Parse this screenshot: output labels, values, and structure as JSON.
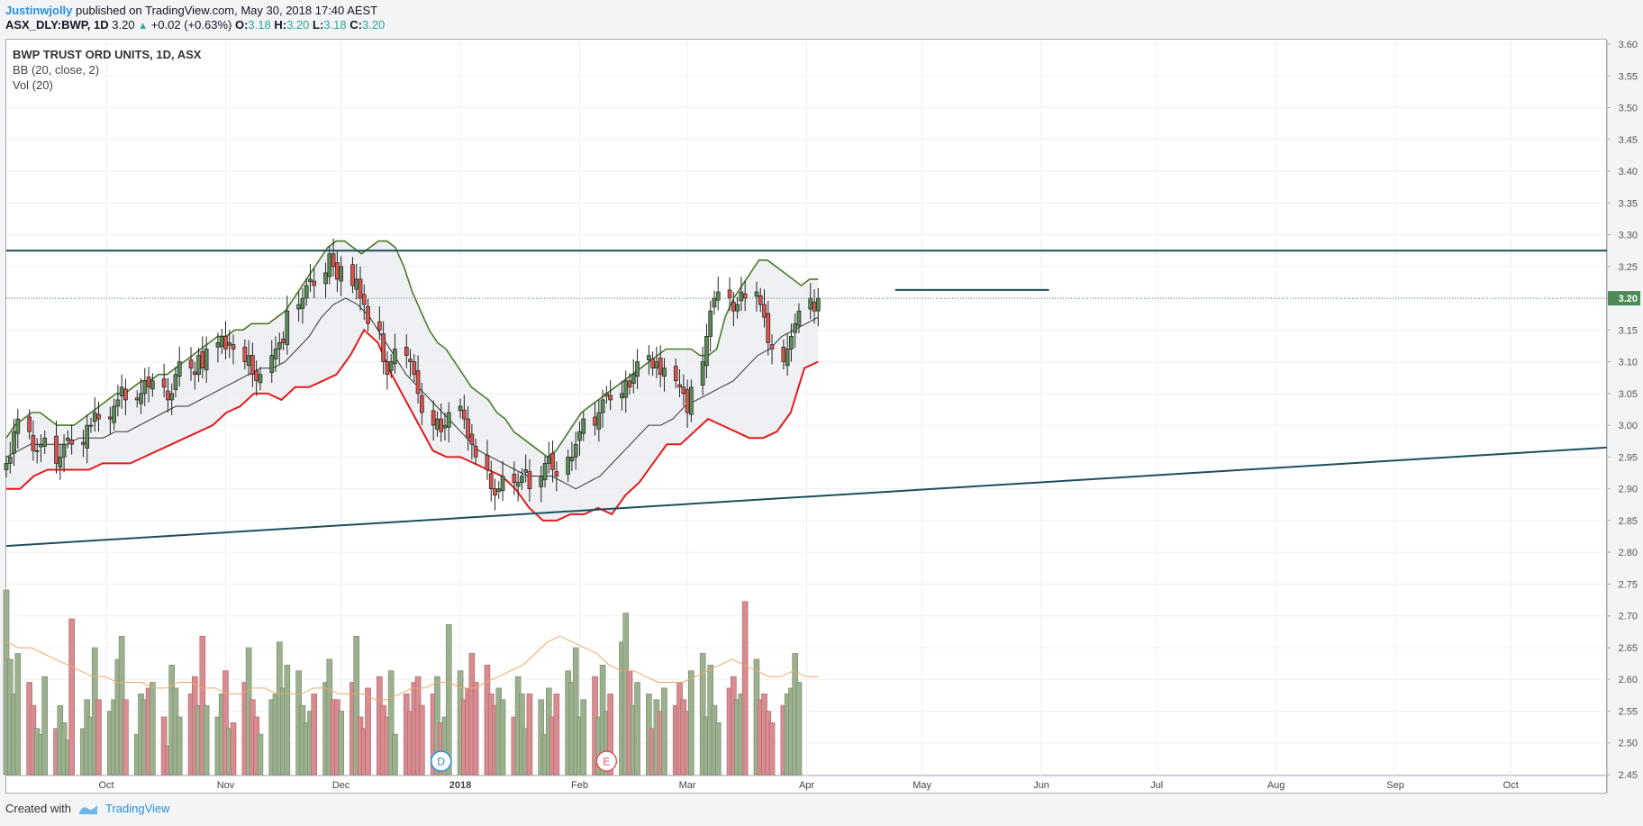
{
  "header": {
    "author": "Justinwjolly",
    "published": "published on TradingView.com, May 30, 2018 17:40 AEST",
    "symbol": "ASX_DLY:BWP, 1D",
    "last": "3.20",
    "change": "+0.02 (+0.63%)",
    "o_label": "O:",
    "o": "3.18",
    "h_label": "H:",
    "h": "3.20",
    "l_label": "L:",
    "l": "3.18",
    "c_label": "C:",
    "c": "3.20"
  },
  "legend": {
    "title": "BWP TRUST ORD UNITS, 1D, ASX",
    "bb": "BB (20, close, 2)",
    "vol": "Vol (20)"
  },
  "footer": {
    "created": "Created with",
    "brand": "TradingView"
  },
  "chart_data": {
    "type": "candlestick",
    "price_axis": {
      "min": 2.45,
      "max": 3.6,
      "step": 0.05,
      "labels": [
        "3.60",
        "3.55",
        "3.50",
        "3.45",
        "3.40",
        "3.35",
        "3.30",
        "3.25",
        "3.20",
        "3.15",
        "3.10",
        "3.05",
        "3.00",
        "2.95",
        "2.90",
        "2.85",
        "2.80",
        "2.75",
        "2.70",
        "2.65",
        "2.60",
        "2.55",
        "2.50",
        "2.45"
      ]
    },
    "last_price_label": "3.20",
    "last_price": 3.2,
    "time_axis": {
      "start": "2017-09-05",
      "end": "2018-10-26",
      "ticks": [
        {
          "date": "2017-10-01",
          "label": "Oct",
          "bold": false
        },
        {
          "date": "2017-11-01",
          "label": "Nov",
          "bold": false
        },
        {
          "date": "2017-12-01",
          "label": "Dec",
          "bold": false
        },
        {
          "date": "2018-01-01",
          "label": "2018",
          "bold": true
        },
        {
          "date": "2018-02-01",
          "label": "Feb",
          "bold": false
        },
        {
          "date": "2018-03-01",
          "label": "Mar",
          "bold": false
        },
        {
          "date": "2018-04-01",
          "label": "Apr",
          "bold": false
        },
        {
          "date": "2018-05-01",
          "label": "May",
          "bold": false
        },
        {
          "date": "2018-06-01",
          "label": "Jun",
          "bold": false
        },
        {
          "date": "2018-07-01",
          "label": "Jul",
          "bold": false
        },
        {
          "date": "2018-08-01",
          "label": "Aug",
          "bold": false
        },
        {
          "date": "2018-09-01",
          "label": "Sep",
          "bold": false
        },
        {
          "date": "2018-10-01",
          "label": "Oct",
          "bold": false
        }
      ]
    },
    "closes": [
      2.94,
      2.95,
      2.99,
      3.01,
      2.99,
      2.96,
      2.96,
      2.97,
      2.98,
      2.94,
      2.95,
      2.97,
      2.98,
      2.97,
      2.97,
      3.0,
      3.0,
      3.02,
      3.01,
      3.01,
      3.03,
      3.04,
      3.06,
      3.04,
      3.04,
      3.05,
      3.07,
      3.06,
      3.07,
      3.06,
      3.04,
      3.05,
      3.08,
      3.1,
      3.09,
      3.08,
      3.11,
      3.09,
      3.12,
      3.13,
      3.14,
      3.12,
      3.13,
      3.12,
      3.1,
      3.11,
      3.08,
      3.07,
      3.08,
      3.11,
      3.12,
      3.13,
      3.13,
      3.18,
      3.19,
      3.2,
      3.22,
      3.23,
      3.22,
      3.24,
      3.27,
      3.25,
      3.23,
      3.25,
      3.22,
      3.23,
      3.2,
      3.19,
      3.16,
      3.15,
      3.1,
      3.08,
      3.1,
      3.12,
      3.11,
      3.1,
      3.08,
      3.05,
      3.02,
      3.0,
      3.01,
      2.99,
      3.0,
      3.02,
      3.03,
      3.01,
      2.98,
      2.97,
      2.95,
      2.93,
      2.9,
      2.89,
      2.9,
      2.92,
      2.91,
      2.91,
      2.92,
      2.93,
      2.9,
      2.92,
      2.94,
      2.95,
      2.93,
      2.92,
      2.95,
      2.95,
      2.97,
      2.99,
      3.01,
      3.0,
      3.02,
      3.04,
      3.05,
      3.04,
      3.05,
      3.07,
      3.06,
      3.08,
      3.1,
      3.11,
      3.09,
      3.1,
      3.08,
      3.09,
      3.07,
      3.06,
      3.05,
      3.02,
      3.06,
      3.1,
      3.14,
      3.18,
      3.2,
      3.21,
      3.2,
      3.18,
      3.19,
      3.21,
      3.2,
      3.21,
      3.19,
      3.17,
      3.13,
      3.12,
      3.1,
      3.12,
      3.14,
      3.16,
      3.18,
      3.2,
      3.18,
      3.2
    ],
    "volumes": [
      3.2,
      2.0,
      1.4,
      2.1,
      1.6,
      1.2,
      0.8,
      0.7,
      1.7,
      0.8,
      1.2,
      0.9,
      0.6,
      2.7,
      0.8,
      1.3,
      1.0,
      2.2,
      1.3,
      1.1,
      1.3,
      2.0,
      2.4,
      1.3,
      0.7,
      1.4,
      1.3,
      1.5,
      1.6,
      1.0,
      0.5,
      1.9,
      1.5,
      1.0,
      1.4,
      1.7,
      1.2,
      2.4,
      1.2,
      1.0,
      1.4,
      1.8,
      0.8,
      0.9,
      1.6,
      2.2,
      1.3,
      1.0,
      0.7,
      1.3,
      1.4,
      2.3,
      1.5,
      1.9,
      1.8,
      1.2,
      0.9,
      1.1,
      1.4,
      1.6,
      2.0,
      1.3,
      1.3,
      1.1,
      1.6,
      2.4,
      1.0,
      0.8,
      1.5,
      1.7,
      1.2,
      1.0,
      1.8,
      0.7,
      1.4,
      1.1,
      1.6,
      1.7,
      1.2,
      1.4,
      1.7,
      0.9,
      1.0,
      2.6,
      1.8,
      1.3,
      1.5,
      2.1,
      1.6,
      1.9,
      1.4,
      1.2,
      1.5,
      1.3,
      1.0,
      1.7,
      1.4,
      0.8,
      1.4,
      1.3,
      0.7,
      1.5,
      1.0,
      1.4,
      1.8,
      1.6,
      2.2,
      1.0,
      1.3,
      1.7,
      1.0,
      1.9,
      1.1,
      1.4,
      2.3,
      2.8,
      1.8,
      1.2,
      1.6,
      1.4,
      0.8,
      1.3,
      1.1,
      1.5,
      1.2,
      1.6,
      1.3,
      1.1,
      1.8,
      2.1,
      1.0,
      1.9,
      1.2,
      0.9,
      1.5,
      1.7,
      1.3,
      1.4,
      3.0,
      2.0,
      1.3,
      1.4,
      1.1,
      0.9,
      1.2,
      1.4,
      1.5,
      2.1,
      1.6
    ],
    "bb_upper": [
      2.98,
      3.0,
      3.01,
      3.02,
      3.02,
      3.01,
      3.0,
      3.0,
      3.0,
      3.01,
      3.02,
      3.03,
      3.04,
      3.05,
      3.05,
      3.06,
      3.07,
      3.07,
      3.08,
      3.08,
      3.09,
      3.1,
      3.11,
      3.12,
      3.13,
      3.14,
      3.14,
      3.15,
      3.15,
      3.16,
      3.16,
      3.16,
      3.17,
      3.18,
      3.2,
      3.22,
      3.24,
      3.26,
      3.28,
      3.29,
      3.29,
      3.28,
      3.27,
      3.28,
      3.29,
      3.29,
      3.28,
      3.25,
      3.21,
      3.18,
      3.15,
      3.13,
      3.12,
      3.1,
      3.08,
      3.06,
      3.05,
      3.04,
      3.02,
      3.01,
      2.99,
      2.98,
      2.97,
      2.96,
      2.95,
      2.96,
      2.98,
      3.0,
      3.02,
      3.03,
      3.04,
      3.05,
      3.06,
      3.07,
      3.08,
      3.09,
      3.1,
      3.11,
      3.12,
      3.12,
      3.12,
      3.12,
      3.11,
      3.11,
      3.12,
      3.17,
      3.2,
      3.22,
      3.24,
      3.26,
      3.26,
      3.25,
      3.24,
      3.23,
      3.22,
      3.23,
      3.23
    ],
    "bb_mid": [
      2.95,
      2.96,
      2.97,
      2.97,
      2.97,
      2.97,
      2.98,
      2.98,
      2.98,
      2.99,
      2.99,
      3.0,
      3.01,
      3.02,
      3.03,
      3.03,
      3.04,
      3.05,
      3.06,
      3.07,
      3.08,
      3.09,
      3.09,
      3.1,
      3.12,
      3.14,
      3.17,
      3.19,
      3.2,
      3.19,
      3.17,
      3.14,
      3.11,
      3.08,
      3.06,
      3.04,
      3.02,
      3.0,
      2.98,
      2.96,
      2.95,
      2.94,
      2.93,
      2.92,
      2.92,
      2.92,
      2.91,
      2.9,
      2.91,
      2.92,
      2.94,
      2.96,
      2.98,
      3.0,
      3.0,
      3.01,
      3.03,
      3.04,
      3.05,
      3.06,
      3.07,
      3.09,
      3.11,
      3.12,
      3.14,
      3.15,
      3.16,
      3.17
    ],
    "bb_lower": [
      2.9,
      2.9,
      2.92,
      2.93,
      2.93,
      2.93,
      2.93,
      2.94,
      2.94,
      2.94,
      2.95,
      2.96,
      2.97,
      2.98,
      2.99,
      3.0,
      3.02,
      3.03,
      3.05,
      3.05,
      3.04,
      3.06,
      3.06,
      3.07,
      3.08,
      3.11,
      3.15,
      3.13,
      3.08,
      3.04,
      3.0,
      2.96,
      2.95,
      2.95,
      2.94,
      2.93,
      2.92,
      2.9,
      2.87,
      2.85,
      2.85,
      2.86,
      2.86,
      2.87,
      2.86,
      2.89,
      2.91,
      2.94,
      2.97,
      2.97,
      2.99,
      3.01,
      3.0,
      2.99,
      2.98,
      2.98,
      2.99,
      3.02,
      3.09,
      3.1
    ],
    "vol_ma": [
      2.3,
      2.2,
      2.2,
      2.1,
      2.0,
      1.9,
      1.8,
      1.7,
      1.7,
      1.6,
      1.6,
      1.6,
      1.5,
      1.5,
      1.6,
      1.6,
      1.5,
      1.5,
      1.4,
      1.4,
      1.5,
      1.5,
      1.4,
      1.4,
      1.4,
      1.5,
      1.5,
      1.4,
      1.4,
      1.4,
      1.3,
      1.3,
      1.4,
      1.5,
      1.5,
      1.6,
      1.6,
      1.5,
      1.5,
      1.6,
      1.7,
      1.8,
      1.9,
      2.1,
      2.3,
      2.4,
      2.3,
      2.2,
      2.1,
      1.9,
      1.8,
      1.8,
      1.7,
      1.6,
      1.6,
      1.6,
      1.7,
      1.8,
      1.9,
      2.0,
      1.9,
      1.8,
      1.7,
      1.7,
      1.8,
      1.7,
      1.7
    ],
    "trendlines": [
      {
        "name": "resistance",
        "from": [
          "2017-09-05",
          3.275
        ],
        "to": [
          "2018-10-26",
          3.275
        ]
      },
      {
        "name": "support",
        "from": [
          "2017-09-05",
          2.81
        ],
        "to": [
          "2018-10-26",
          2.965
        ]
      },
      {
        "name": "local-resistance",
        "from": [
          "2018-04-24",
          3.213
        ],
        "to": [
          "2018-06-03",
          3.213
        ]
      }
    ],
    "events": [
      {
        "date": "2017-12-27",
        "label": "D",
        "color": "#2a8fd8"
      },
      {
        "date": "2018-02-08",
        "label": "E",
        "color": "#e0535b"
      }
    ],
    "colors": {
      "up": "#5a8a55",
      "down": "#d9534f",
      "bb_upper": "#4a7a2b",
      "bb_lower": "#e21b1b",
      "bb_mid": "#333333",
      "trend": "#1b4f5c",
      "vol_up": "#9cb08f",
      "vol_down": "#d58d92",
      "vol_ma": "#f0a868"
    }
  }
}
